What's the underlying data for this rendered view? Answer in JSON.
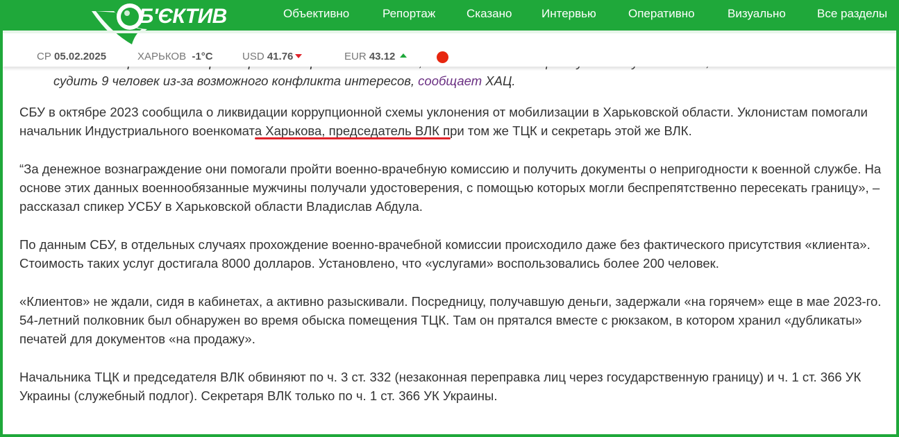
{
  "header": {
    "logo_text": "Б'ЄКТИВ",
    "nav": [
      "Объективно",
      "Репортаж",
      "Сказано",
      "Интервью",
      "Оперативно",
      "Визуально",
      "Все разделы"
    ]
  },
  "infobar": {
    "date_prefix": "СР",
    "date": "05.02.2025",
    "city": "ХАРЬКОВ",
    "temperature": "-1°C",
    "usd_label": "USD",
    "usd_value": "41.76",
    "usd_trend": "down",
    "eur_label": "EUR",
    "eur_value": "43.12",
    "eur_trend": "up"
  },
  "article": {
    "quote_line1": "Начальника районного ТЦК с Харькова и председателя ВЛК, совместно с помощью мужчинам уклонистам, отказалось",
    "quote_line2_start": "судить 9 человек из-за возможного конфликта интересов,",
    "quote_link": "сообщает",
    "quote_line2_end": "ХАЦ.",
    "p1_before": "СБУ в октябре 2023 сообщила о ликвидации коррупционной схемы уклонения от мобилизации в Харьковской области. Уклонистам помогали начальник ",
    "p1_highlight": "Индустриального военкомата",
    "p1_after": " Харькова, председатель ВЛК при том же ТЦК и секретарь этой же ВЛК.",
    "p2": "“За денежное вознаграждение они помогали пройти военно-врачебную комиссию и получить документы о непригодности к военной службе. На основе этих данных военнообязанные мужчины получали удостоверения, с помощью которых могли беспрепятственно пересекать границу», – рассказал спикер УСБУ в Харьковской области Владислав Абдула.",
    "p3": "По данным СБУ, в отдельных случаях прохождение военно-врачебной комиссии происходило даже без фактического присутствия «клиента». Стоимость таких услуг достигала 8000 долларов. Установлено, что «услугами» воспользовались более 200 человек.",
    "p4": "«Клиентов» не ждали, сидя в кабинетах, а активно разыскивали. Посредницу, получавшую деньги, задержали «на горячем» еще в мае 2023-го. 54-летний полковник был обнаружен во время обыска помещения ТЦК. Там он прятался вместе с рюкзаком, в котором хранил «дубликаты» печатей для документов «на продажу».",
    "p5": "Начальника ТЦК и председателя ВЛК обвиняют по ч. 3 ст. 332 (незаконная переправка лиц через государственную границу) и ч. 1 ст. 366 УК Украины (служебный подлог). Секретаря ВЛК только по ч. 1 ст. 366 УК Украины."
  },
  "colors": {
    "brand_green": "#1fa83a",
    "down_red": "#e0232b",
    "link_purple": "#6a2f82",
    "dot_red": "#e7260f"
  }
}
